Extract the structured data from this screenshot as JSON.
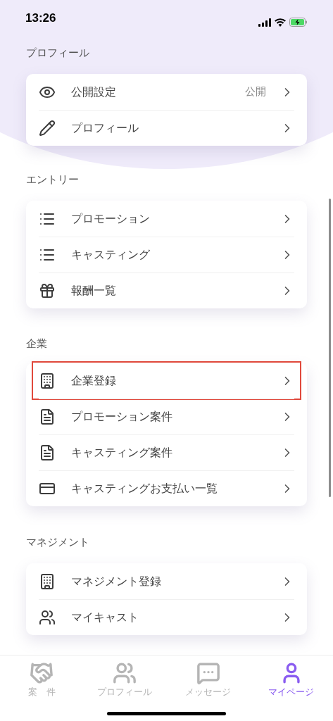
{
  "status_bar": {
    "time": "13:26"
  },
  "sections": [
    {
      "title": "プロフィール",
      "items": [
        {
          "kind": "eye",
          "label": "公開設定",
          "value": "公開",
          "highlighted": false
        },
        {
          "kind": "pencil",
          "label": "プロフィール",
          "highlighted": false
        }
      ]
    },
    {
      "title": "エントリー",
      "items": [
        {
          "kind": "list",
          "label": "プロモーション",
          "highlighted": false
        },
        {
          "kind": "list",
          "label": "キャスティング",
          "highlighted": false
        },
        {
          "kind": "gift",
          "label": "報酬一覧",
          "highlighted": false
        }
      ]
    },
    {
      "title": "企業",
      "items": [
        {
          "kind": "building",
          "label": "企業登録",
          "highlighted": true
        },
        {
          "kind": "document",
          "label": "プロモーション案件",
          "highlighted": false
        },
        {
          "kind": "document",
          "label": "キャスティング案件",
          "highlighted": false
        },
        {
          "kind": "card",
          "label": "キャスティングお支払い一覧",
          "highlighted": false
        }
      ]
    },
    {
      "title": "マネジメント",
      "items": [
        {
          "kind": "building",
          "label": "マネジメント登録",
          "highlighted": false
        },
        {
          "kind": "people",
          "label": "マイキャスト",
          "highlighted": false
        }
      ]
    }
  ],
  "tab_bar": [
    {
      "kind": "handshake",
      "label": "案　件",
      "selected": false
    },
    {
      "kind": "people",
      "label": "プロフィール",
      "selected": false
    },
    {
      "kind": "message",
      "label": "メッセージ",
      "selected": false
    },
    {
      "kind": "person",
      "label": "マイページ",
      "selected": true
    }
  ]
}
